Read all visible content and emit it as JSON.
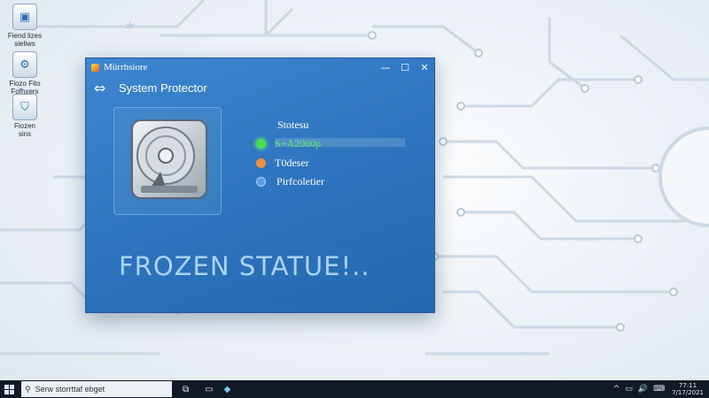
{
  "desktop": {
    "icons": [
      {
        "label": "Fiend lizes\nsieliws",
        "icon": "app-icon"
      },
      {
        "label": "Fiozo Fito\nFofhxers",
        "icon": "settings-icon"
      },
      {
        "label": "Fiozen\nsins",
        "icon": "shield-icon"
      }
    ]
  },
  "window": {
    "title": "Mürrhsiore",
    "controls": {
      "minimize": "—",
      "maximize": "☐",
      "close": "✕"
    },
    "back_glyph": "⇔",
    "app_title": "System Protector",
    "status_title": "Stotesu",
    "status_items": [
      {
        "label": "S+A2000p",
        "color": "#5ef060"
      },
      {
        "label": "T0deser",
        "color": "#ffffff"
      },
      {
        "label": "Pirfcoletier",
        "color": "#ffffff"
      }
    ],
    "status_fill": 1.0,
    "banner": "FROZEN STATUE!.."
  },
  "taskbar": {
    "search_text": "Serw storrttaf ebget",
    "search_icon": "search-icon",
    "tray": [
      "^",
      "▭",
      "🔊",
      "⌨"
    ],
    "clock": [
      "77:11",
      "7/17/2021"
    ]
  },
  "colors": {
    "window_blue": "#2d73bd",
    "frozen_text": "#a9d4f6",
    "status_green": "#45e04f",
    "status_orange": "#f08f3c"
  }
}
